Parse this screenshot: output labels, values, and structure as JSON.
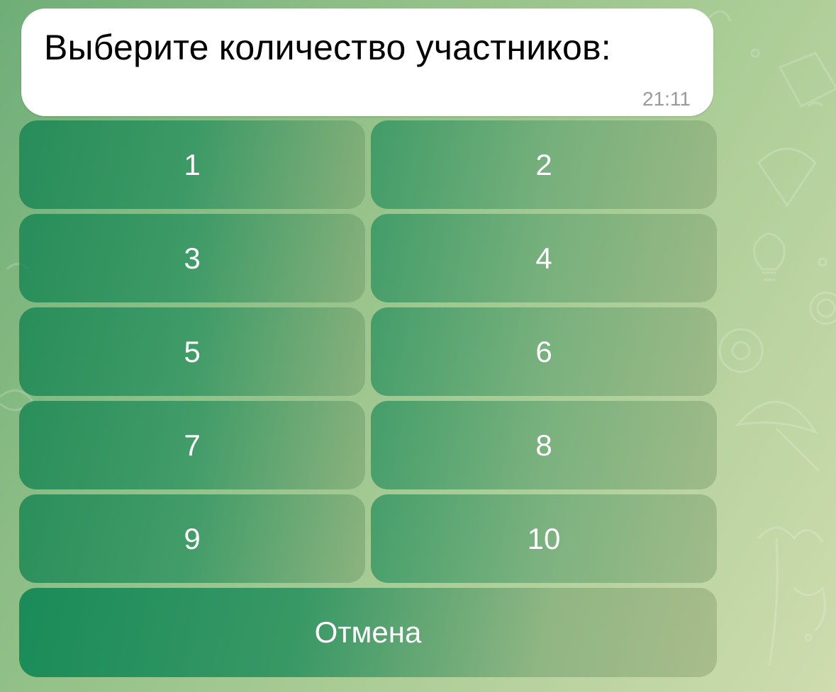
{
  "message": {
    "text": "Выберите количество участников:",
    "time": "21:11"
  },
  "keyboard": {
    "rows": [
      [
        "1",
        "2"
      ],
      [
        "3",
        "4"
      ],
      [
        "5",
        "6"
      ],
      [
        "7",
        "8"
      ],
      [
        "9",
        "10"
      ]
    ],
    "cancel_label": "Отмена"
  },
  "colors": {
    "bubble_background": "#ffffff",
    "button_green": "#1a8a5a",
    "time_text": "#9a9a9a"
  }
}
